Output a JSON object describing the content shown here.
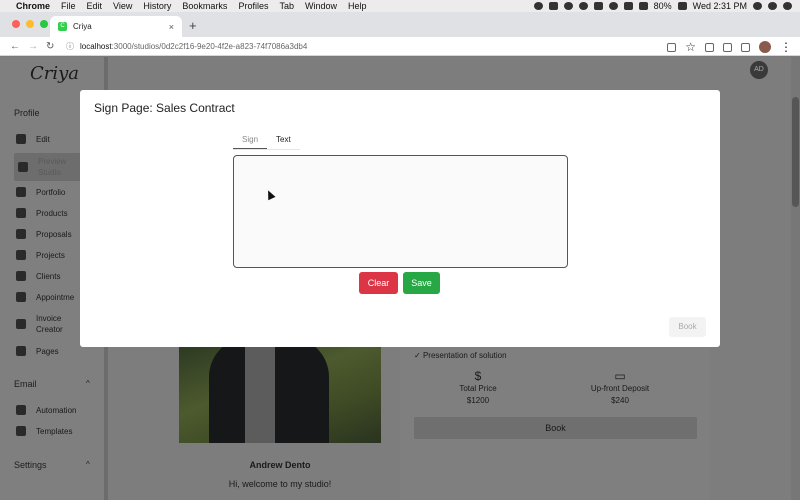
{
  "menubar": {
    "app": "Chrome",
    "items": [
      "File",
      "Edit",
      "View",
      "History",
      "Bookmarks",
      "Profiles",
      "Tab",
      "Window",
      "Help"
    ],
    "battery": "80%",
    "datetime": "Wed 2:31 PM"
  },
  "browser": {
    "tab_title": "Criya",
    "tab_close": "×",
    "new_tab": "+",
    "url_host": "localhost",
    "url_rest": ":3000/studios/0d2c2f16-9e20-4f2e-a823-74f7086a3db4"
  },
  "sidebar": {
    "logo": "Criya",
    "profile_section": "Profile",
    "items": [
      "Edit",
      "Preview Studio",
      "Portfolio",
      "Products",
      "Proposals",
      "Projects",
      "Clients",
      "Appointme",
      "Invoice Creator",
      "Pages"
    ],
    "email_section": "Email",
    "email_items": [
      "Automation",
      "Templates"
    ],
    "settings_section": "Settings"
  },
  "page": {
    "avatar_initials": "AD",
    "person_name": "Andrew Dento",
    "welcome_text": "Hi, welcome to my studio!",
    "feature": "Presentation of solution",
    "total_price_label": "Total Price",
    "total_price_value": "$1200",
    "deposit_label": "Up-front Deposit",
    "deposit_value": "$240",
    "book_label": "Book"
  },
  "modal": {
    "title": "Sign Page: Sales Contract",
    "tabs": [
      "Sign",
      "Text"
    ],
    "active_tab": "Sign",
    "clear_label": "Clear",
    "save_label": "Save",
    "book_label": "Book"
  },
  "colors": {
    "clear": "#dc3545",
    "save": "#28a745",
    "overlay": "#7d7d7d"
  }
}
